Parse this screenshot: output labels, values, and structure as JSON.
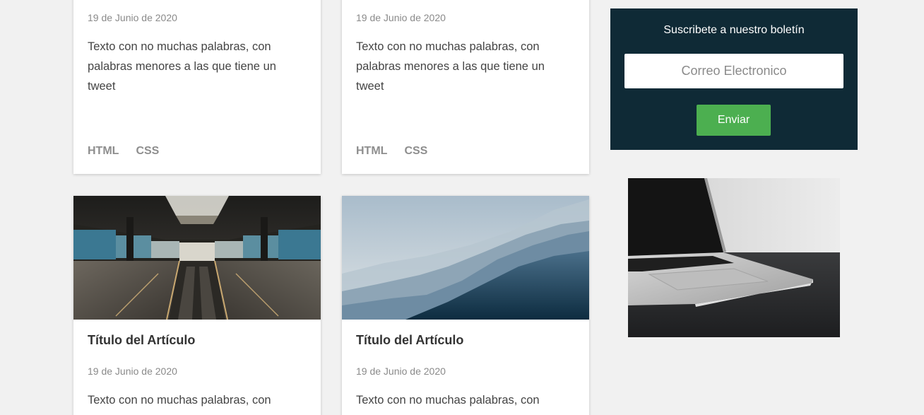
{
  "cards_top": [
    {
      "date": "19 de Junio de 2020",
      "text": "Texto con no muchas palabras, con palabras menores a las que tiene un tweet",
      "tags": [
        "HTML",
        "CSS"
      ]
    },
    {
      "date": "19 de Junio de 2020",
      "text": "Texto con no muchas palabras, con palabras menores a las que tiene un tweet",
      "tags": [
        "HTML",
        "CSS"
      ]
    }
  ],
  "cards_bottom": [
    {
      "image": "escalator-station-photo",
      "title": "Título del Artículo",
      "date": "19 de Junio de 2020",
      "text": "Texto con no muchas palabras, con"
    },
    {
      "image": "misty-mountains-photo",
      "title": "Título del Artículo",
      "date": "19 de Junio de 2020",
      "text": "Texto con no muchas palabras, con"
    }
  ],
  "newsletter": {
    "title": "Suscribete a nuestro boletín",
    "input_placeholder": "Correo Electronico",
    "button_label": "Enviar",
    "background_color": "#0f2a36",
    "button_color": "#4caf50"
  },
  "sidebar_image": "laptop-photo",
  "colors": {
    "page_background": "#f1f1f1",
    "card_background": "#ffffff"
  }
}
